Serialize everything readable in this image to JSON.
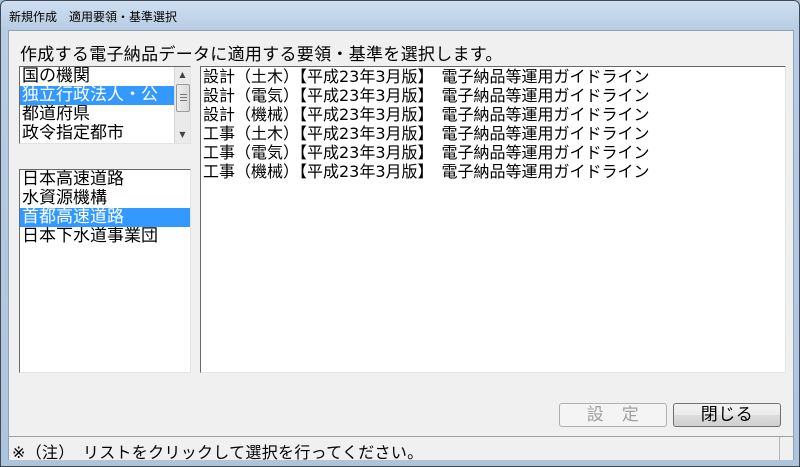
{
  "window": {
    "title": "新規作成　適用要領・基準選択"
  },
  "instruction": "作成する電子納品データに適用する要領・基準を選択します。",
  "organization_types": {
    "items": [
      {
        "label": "国の機関",
        "selected": false
      },
      {
        "label": "独立行政法人・公",
        "selected": true
      },
      {
        "label": "都道府県",
        "selected": false
      },
      {
        "label": "政令指定都市",
        "selected": false
      }
    ]
  },
  "organizations": {
    "items": [
      {
        "label": "日本高速道路",
        "selected": false
      },
      {
        "label": "水資源機構",
        "selected": false
      },
      {
        "label": "首都高速道路",
        "selected": true
      },
      {
        "label": "日本下水道事業団",
        "selected": false
      }
    ]
  },
  "guidelines": {
    "items": [
      {
        "label": "設計（土木）【平成23年3月版】　電子納品等運用ガイドライン"
      },
      {
        "label": "設計（電気）【平成23年3月版】　電子納品等運用ガイドライン"
      },
      {
        "label": "設計（機械）【平成23年3月版】　電子納品等運用ガイドライン"
      },
      {
        "label": "工事（土木）【平成23年3月版】　電子納品等運用ガイドライン"
      },
      {
        "label": "工事（電気）【平成23年3月版】　電子納品等運用ガイドライン"
      },
      {
        "label": "工事（機械）【平成23年3月版】　電子納品等運用ガイドライン"
      }
    ]
  },
  "buttons": {
    "set_label": "設　定",
    "close_label": "閉じる"
  },
  "status": {
    "note": "※（注）　リストをクリックして選択を行ってください。"
  },
  "scrollbar": {
    "up_icon": "arrow-up-icon",
    "down_icon": "arrow-down-icon"
  }
}
